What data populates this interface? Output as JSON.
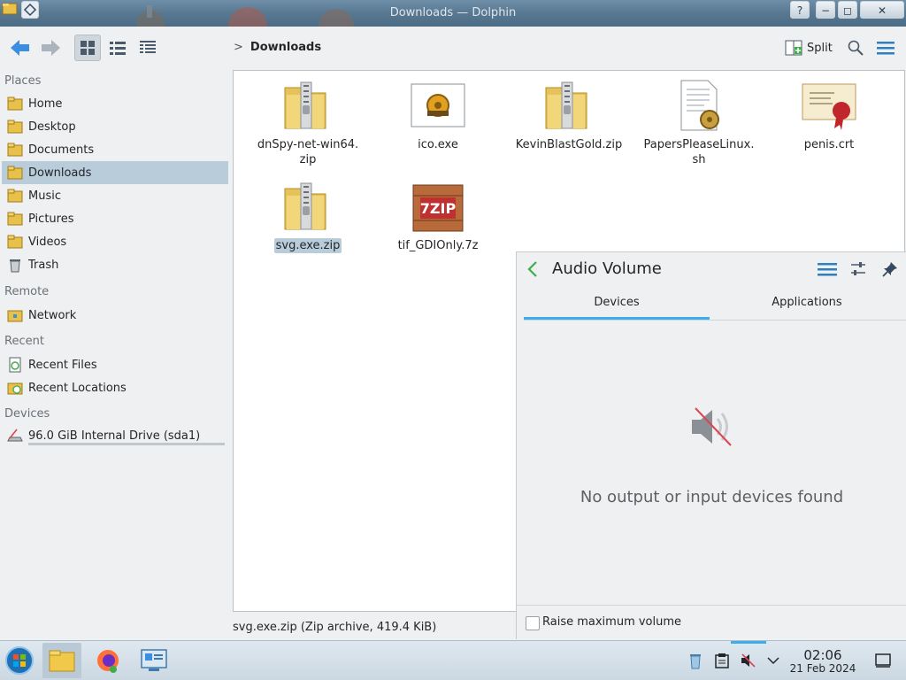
{
  "window": {
    "title": "Downloads — Dolphin",
    "help_glyph": "?",
    "min_glyph": "−",
    "max_glyph": "◻",
    "close_glyph": "✕"
  },
  "toolbar": {
    "breadcrumb_chevron": ">",
    "breadcrumb": "Downloads",
    "split_label": "Split"
  },
  "sidebar": {
    "places_header": "Places",
    "places": [
      {
        "label": "Home",
        "icon": "home-folder-icon"
      },
      {
        "label": "Desktop",
        "icon": "desktop-icon"
      },
      {
        "label": "Documents",
        "icon": "documents-icon"
      },
      {
        "label": "Downloads",
        "icon": "downloads-folder-icon",
        "selected": true
      },
      {
        "label": "Music",
        "icon": "music-icon"
      },
      {
        "label": "Pictures",
        "icon": "pictures-icon"
      },
      {
        "label": "Videos",
        "icon": "videos-icon"
      },
      {
        "label": "Trash",
        "icon": "trash-icon"
      }
    ],
    "remote_header": "Remote",
    "remote": [
      {
        "label": "Network",
        "icon": "network-icon"
      }
    ],
    "recent_header": "Recent",
    "recent": [
      {
        "label": "Recent Files",
        "icon": "recent-files-icon"
      },
      {
        "label": "Recent Locations",
        "icon": "recent-locations-icon"
      }
    ],
    "devices_header": "Devices",
    "devices": [
      {
        "label": "96.0 GiB Internal Drive (sda1)",
        "icon": "drive-icon"
      }
    ]
  },
  "files": [
    {
      "name": "dnSpy-net-win64.\nzip",
      "icon": "zip-icon"
    },
    {
      "name": "ico.exe",
      "icon": "exe-gear-icon"
    },
    {
      "name": "KevinBlastGold.zip",
      "icon": "zip-icon"
    },
    {
      "name": "PapersPleaseLinux.\nsh",
      "icon": "shell-script-icon"
    },
    {
      "name": "penis.crt",
      "icon": "certificate-icon"
    },
    {
      "name": "svg.exe.zip",
      "icon": "zip-icon",
      "selected": true
    },
    {
      "name": "tif_GDIOnly.7z",
      "icon": "7zip-icon"
    }
  ],
  "statusbar": {
    "text": "svg.exe.zip (Zip archive, 419.4 KiB)"
  },
  "audio_popup": {
    "title": "Audio Volume",
    "tabs": [
      "Devices",
      "Applications"
    ],
    "active_tab": "Devices",
    "empty_message": "No output or input devices found",
    "raise_max_label": "Raise maximum volume",
    "raise_max_checked": false
  },
  "taskbar": {
    "clock_time": "02:06",
    "clock_date": "21 Feb 2024",
    "apps": [
      "start-menu-icon",
      "dolphin-icon",
      "firefox-icon",
      "system-settings-icon"
    ]
  },
  "colors": {
    "accent": "#3daee9",
    "selection": "#b8ccd9",
    "titlebar": "#5a7a94"
  }
}
